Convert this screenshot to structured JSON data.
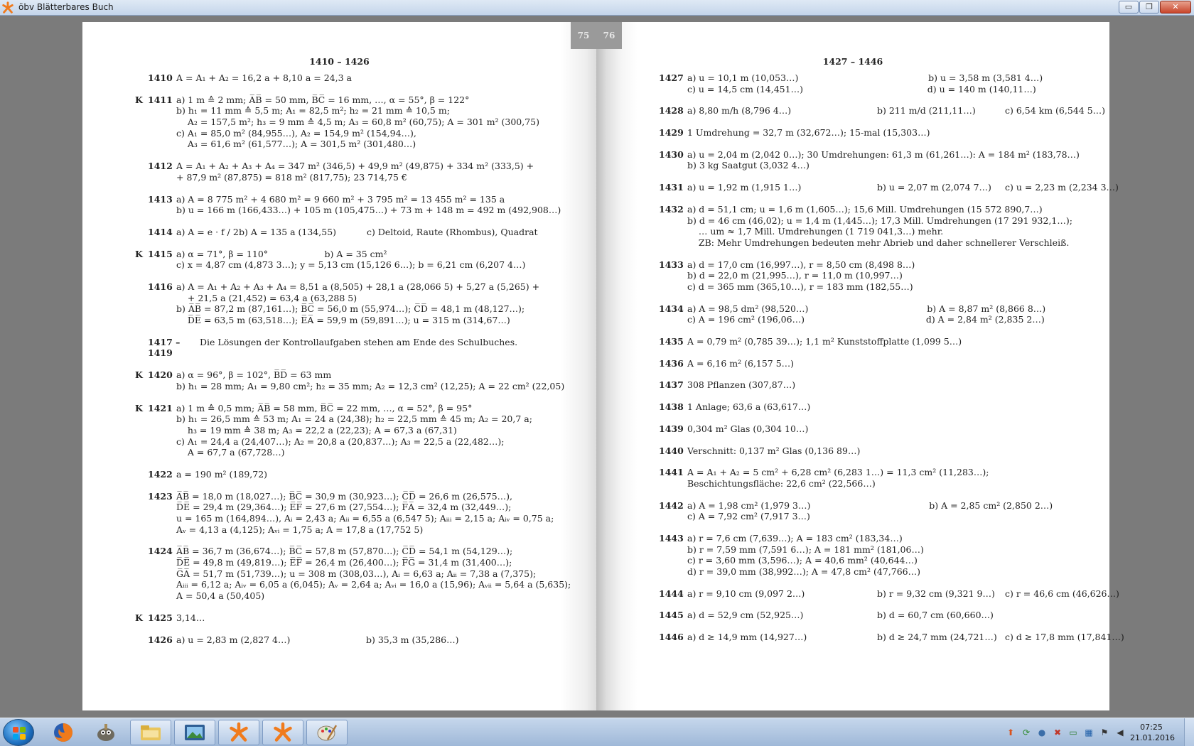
{
  "window": {
    "title": "öbv Blätterbares Buch",
    "controls": {
      "minimize": "▭",
      "restore": "❐",
      "close": "✕"
    }
  },
  "left_page": {
    "page_number": "75",
    "header": "1410 – 1426",
    "entries": [
      {
        "k": "",
        "num": "1410",
        "lines": [
          "A = A₁ + A₂ = 16,2 a + 8,10 a = 24,3 a"
        ]
      },
      {
        "k": "K",
        "num": "1411",
        "lines": [
          "a) 1 m ≙ 2 mm; A̅B̅ = 50 mm, B̅C̅ = 16 mm, …, α = 55°, β = 122°",
          "b) h₁ = 11 mm ≙ 5,5 m; A₁ = 82,5 m²; h₂ = 21 mm ≙ 10,5 m;",
          "    A₂ = 157,5 m²; h₃ = 9 mm ≙ 4,5 m; A₃ = 60,8 m² (60,75); A = 301 m² (300,75)",
          "c) A₁ = 85,0 m² (84,955…), A₂ = 154,9 m² (154,94…),",
          "    A₃ = 61,6 m² (61,577…); A = 301,5 m² (301,480…)"
        ]
      },
      {
        "k": "",
        "num": "1412",
        "lines": [
          "A = A₁ + A₂ + A₃ + A₄ = 347 m² (346,5) + 49,9 m² (49,875) + 334 m² (333,5) +",
          "+ 87,9 m² (87,875) = 818 m² (817,75); 23 714,75 €"
        ]
      },
      {
        "k": "",
        "num": "1413",
        "lines": [
          "a) A = 8 775 m² + 4 680 m² = 9 660 m² + 3 795 m² = 13 455 m² = 135 a",
          "b) u = 166 m (166,433…) + 105 m (105,475…) + 73 m + 148 m = 492 m (492,908…)"
        ]
      },
      {
        "k": "",
        "num": "1414",
        "cols": [
          "a) A = e · f / 2",
          "b) A = 135 a (134,55)",
          "c) Deltoid, Raute (Rhombus), Quadrat"
        ]
      },
      {
        "k": "K",
        "num": "1415",
        "lines": [
          "a) α = 71°, β = 110°                    b) A = 35 cm²",
          "c) x = 4,87 cm (4,873 3…); y = 5,13 cm (15,126 6…); b = 6,21 cm (6,207 4…)"
        ]
      },
      {
        "k": "",
        "num": "1416",
        "lines": [
          "a) A = A₁ + A₂ + A₃ + A₄ = 8,51 a (8,505) + 28,1 a (28,066 5) + 5,27 a (5,265) +",
          "    + 21,5 a (21,452) = 63,4 a (63,288 5)",
          "b) A̅B̅ = 87,2 m (87,161…); B̅C̅ = 56,0 m (55,974…); C̅D̅ = 48,1 m (48,127…);",
          "    D̅E̅ = 63,5 m (63,518…); E̅A̅ = 59,9 m (59,891…); u = 315 m (314,67…)"
        ]
      },
      {
        "k": "",
        "num": "1417 – 1419",
        "wide": true,
        "lines": [
          "Die Lösungen der Kontrollaufgaben stehen am Ende des Schulbuches."
        ]
      },
      {
        "k": "K",
        "num": "1420",
        "lines": [
          "a) α = 96°, β = 102°, B̅D̅ = 63 mm",
          "b) h₁ = 28 mm; A₁ = 9,80 cm²; h₂ = 35 mm; A₂ = 12,3 cm² (12,25); A = 22 cm² (22,05)"
        ]
      },
      {
        "k": "K",
        "num": "1421",
        "lines": [
          "a) 1 m ≙ 0,5 mm; A̅B̅ = 58 mm, B̅C̅ = 22 mm, …, α = 52°, β = 95°",
          "b) h₁ = 26,5 mm ≙ 53 m; A₁ = 24 a (24,38); h₂ = 22,5 mm ≙ 45 m; A₂ = 20,7 a;",
          "    h₃ = 19 mm ≙ 38 m; A₃ = 22,2 a (22,23); A = 67,3 a (67,31)",
          "c) A₁ = 24,4 a (24,407…); A₂ = 20,8 a (20,837…); A₃ = 22,5 a (22,482…);",
          "    A = 67,7 a (67,728…)"
        ]
      },
      {
        "k": "",
        "num": "1422",
        "lines": [
          "a = 190 m² (189,72)"
        ]
      },
      {
        "k": "",
        "num": "1423",
        "lines": [
          "A̅B̅ = 18,0 m (18,027…); B̅C̅ = 30,9 m (30,923…); C̅D̅ = 26,6 m (26,575…),",
          "D̅E̅ = 29,4 m (29,364…); E̅F̅ = 27,6 m (27,554…); F̅A̅ = 32,4 m (32,449…);",
          "u = 165 m (164,894…), Aᵢ = 2,43 a; Aᵢᵢ = 6,55 a (6,547 5); Aᵢᵢᵢ = 2,15 a; Aᵢᵥ = 0,75 a;",
          "Aᵥ = 4,13 a (4,125); Aᵥᵢ = 1,75 a; A = 17,8 a (17,752 5)"
        ]
      },
      {
        "k": "",
        "num": "1424",
        "lines": [
          "A̅B̅ = 36,7 m (36,674…); B̅C̅ = 57,8 m (57,870…); C̅D̅ = 54,1 m (54,129…);",
          "D̅E̅ = 49,8 m (49,819…); E̅F̅ = 26,4 m (26,400…); F̅G̅ = 31,4 m (31,400…);",
          "G̅A̅ = 51,7 m (51,739…); u = 308 m (308,03…), Aᵢ = 6,63 a; Aᵢᵢ = 7,38 a (7,375);",
          "Aᵢᵢᵢ = 6,12 a; Aᵢᵥ = 6,05 a (6,045); Aᵥ = 2,64 a; Aᵥᵢ = 16,0 a (15,96); Aᵥᵢᵢ = 5,64 a (5,635);",
          "A = 50,4 a (50,405)"
        ]
      },
      {
        "k": "K",
        "num": "1425",
        "lines": [
          "3,14…"
        ]
      },
      {
        "k": "",
        "num": "1426",
        "cols": [
          "a) u = 2,83 m (2,827 4…)",
          "b) 35,3 m (35,286…)"
        ]
      }
    ]
  },
  "right_page": {
    "page_number": "76",
    "header": "1427 – 1446",
    "entries": [
      {
        "k": "",
        "num": "1427",
        "lines": [
          "a) u = 10,1 m (10,053…)                                              b) u = 3,58 m (3,581 4…)",
          "c) u = 14,5 cm (14,451…)                                            d) u = 140 m (140,11…)"
        ]
      },
      {
        "k": "",
        "num": "1428",
        "cols": [
          "a) 8,80 m/h (8,796 4…)",
          "b) 211 m/d (211,11…)",
          "c) 6,54 km (6,544 5…)"
        ]
      },
      {
        "k": "",
        "num": "1429",
        "lines": [
          "1 Umdrehung = 32,7 m (32,672…); 15-mal (15,303…)"
        ]
      },
      {
        "k": "",
        "num": "1430",
        "lines": [
          "a) u = 2,04 m (2,042 0…); 30 Umdrehungen: 61,3 m (61,261…): A = 184 m² (183,78…)",
          "b) 3 kg Saatgut (3,032 4…)"
        ]
      },
      {
        "k": "",
        "num": "1431",
        "cols": [
          "a) u = 1,92 m (1,915 1…)",
          "b) u = 2,07 m (2,074 7…)",
          "c) u = 2,23 m (2,234 3…)"
        ]
      },
      {
        "k": "",
        "num": "1432",
        "lines": [
          "a) d = 51,1 cm; u = 1,6 m (1,605…); 15,6 Mill. Umdrehungen (15 572 890,7…)",
          "b) d = 46 cm (46,02); u = 1,4 m (1,445…); 17,3 Mill. Umdrehungen (17 291 932,1…);",
          "    … um ≈ 1,7 Mill. Umdrehungen (1 719 041,3…) mehr.",
          "    ZB: Mehr Umdrehungen bedeuten mehr Abrieb und daher schnellerer Verschleiß."
        ]
      },
      {
        "k": "",
        "num": "1433",
        "lines": [
          "a) d = 17,0 cm (16,997…), r = 8,50 cm (8,498 8…)",
          "b) d = 22,0 m (21,995…), r = 11,0 m (10,997…)",
          "c) d = 365 mm (365,10…), r = 183 mm (182,55…)"
        ]
      },
      {
        "k": "",
        "num": "1434",
        "lines": [
          "a) A = 98,5 dm² (98,520…)                                          b) A = 8,87 m² (8,866 8…)",
          "c) A = 196 cm² (196,06…)                                           d) A = 2,84 m² (2,835 2…)"
        ]
      },
      {
        "k": "",
        "num": "1435",
        "lines": [
          "A = 0,79 m² (0,785 39…); 1,1 m² Kunststoffplatte (1,099 5…)"
        ]
      },
      {
        "k": "",
        "num": "1436",
        "lines": [
          "A = 6,16 m² (6,157 5…)"
        ]
      },
      {
        "k": "",
        "num": "1437",
        "lines": [
          "308 Pflanzen (307,87…)"
        ]
      },
      {
        "k": "",
        "num": "1438",
        "lines": [
          "1 Anlage; 63,6 a (63,617…)"
        ]
      },
      {
        "k": "",
        "num": "1439",
        "lines": [
          "0,304 m² Glas (0,304 10…)"
        ]
      },
      {
        "k": "",
        "num": "1440",
        "lines": [
          "Verschnitt: 0,137 m² Glas (0,136 89…)"
        ]
      },
      {
        "k": "",
        "num": "1441",
        "lines": [
          "A = A₁ + A₂ = 5 cm² + 6,28 cm² (6,283 1…) = 11,3 cm² (11,283…);",
          "Beschichtungsfläche: 22,6 cm² (22,566…)"
        ]
      },
      {
        "k": "",
        "num": "1442",
        "lines": [
          "a) A = 1,98 cm² (1,979 3…)                                          b) A = 2,85 cm² (2,850 2…)",
          "c) A = 7,92 cm² (7,917 3…)"
        ]
      },
      {
        "k": "",
        "num": "1443",
        "lines": [
          "a) r = 7,6 cm (7,639…); A = 183 cm² (183,34…)",
          "b) r = 7,59 mm (7,591 6…); A = 181 mm² (181,06…)",
          "c) r = 3,60 mm (3,596…); A = 40,6 mm² (40,644…)",
          "d) r = 39,0 mm (38,992…); A = 47,8 cm² (47,766…)"
        ]
      },
      {
        "k": "",
        "num": "1444",
        "cols": [
          "a) r = 9,10 cm (9,097 2…)",
          "b) r = 9,32 cm (9,321 9…)",
          "c) r = 46,6 cm (46,626…)"
        ]
      },
      {
        "k": "",
        "num": "1445",
        "cols": [
          "a) d = 52,9 cm (52,925…)",
          "b) d = 60,7 cm (60,660…)"
        ]
      },
      {
        "k": "",
        "num": "1446",
        "cols": [
          "a) d ≥ 14,9 mm (14,927…)",
          "b) d ≥ 24,7 mm (24,721…)",
          "c) d ≥ 17,8 mm (17,841…)"
        ]
      }
    ]
  },
  "taskbar": {
    "clock_time": "07:25",
    "clock_date": "21.01.2016",
    "items": [
      "firefox-icon",
      "gimp-icon",
      "file-explorer-icon",
      "image-viewer-icon",
      "oebv-book-icon",
      "oebv-book-icon",
      "paint-icon"
    ]
  }
}
